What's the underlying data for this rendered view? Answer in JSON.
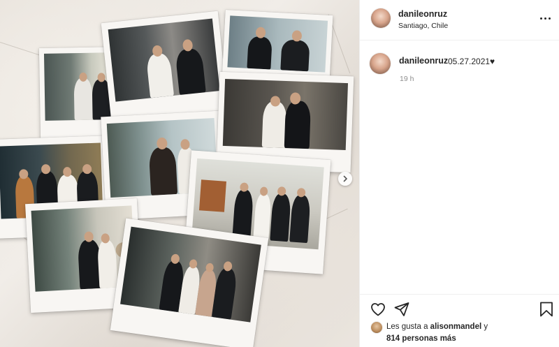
{
  "post": {
    "username": "danileonruz",
    "location": "Santiago, Chile",
    "caption_user": "danileonruz",
    "caption_text": "05.27.2021♥",
    "time_ago": "19 h"
  },
  "likes": {
    "prefix": "Les gusta a",
    "first_user": "alisonmandel",
    "joiner": "y",
    "others": "814 personas más"
  },
  "icons": {
    "more": "more-options-icon",
    "like": "heart-icon",
    "share": "paper-plane-icon",
    "save": "bookmark-icon",
    "next": "chevron-right-icon"
  },
  "colors": {
    "text": "#262626",
    "muted": "#8e8e8e",
    "border": "#efefef"
  }
}
